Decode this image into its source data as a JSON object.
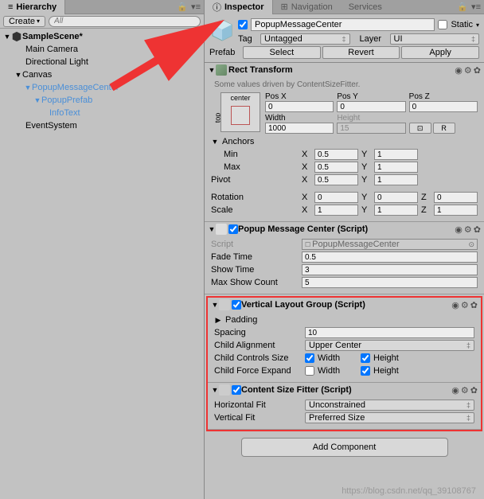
{
  "hierarchy": {
    "title": "Hierarchy",
    "create": "Create",
    "search_placeholder": "All",
    "scene": "SampleScene*",
    "items": [
      "Main Camera",
      "Directional Light",
      "Canvas",
      "PopupMessageCenter",
      "PopupPrefab",
      "InfoText",
      "EventSystem"
    ]
  },
  "inspector": {
    "tabs": {
      "inspector": "Inspector",
      "navigation": "Navigation",
      "services": "Services"
    },
    "name": "PopupMessageCenter",
    "static_label": "Static",
    "tag_label": "Tag",
    "tag_value": "Untagged",
    "layer_label": "Layer",
    "layer_value": "UI",
    "prefab_label": "Prefab",
    "prefab_select": "Select",
    "prefab_revert": "Revert",
    "prefab_apply": "Apply"
  },
  "rect_transform": {
    "title": "Rect Transform",
    "info": "Some values driven by ContentSizeFitter.",
    "preset_h": "center",
    "preset_v": "top",
    "posx_label": "Pos X",
    "posx": "0",
    "posy_label": "Pos Y",
    "posy": "0",
    "posz_label": "Pos Z",
    "posz": "0",
    "width_label": "Width",
    "width": "1000",
    "height_label": "Height",
    "height": "15",
    "blueprint": "⊡",
    "raw": "R",
    "anchors_label": "Anchors",
    "min_label": "Min",
    "min_x": "0.5",
    "min_y": "1",
    "max_label": "Max",
    "max_x": "0.5",
    "max_y": "1",
    "pivot_label": "Pivot",
    "pivot_x": "0.5",
    "pivot_y": "1",
    "rotation_label": "Rotation",
    "rot_x": "0",
    "rot_y": "0",
    "rot_z": "0",
    "scale_label": "Scale",
    "scale_x": "1",
    "scale_y": "1",
    "scale_z": "1"
  },
  "popup_script": {
    "title": "Popup Message Center (Script)",
    "script_label": "Script",
    "script_value": "PopupMessageCenter",
    "fade_label": "Fade Time",
    "fade": "0.5",
    "show_label": "Show Time",
    "show": "3",
    "max_label": "Max Show Count",
    "max": "5"
  },
  "vlg": {
    "title": "Vertical Layout Group (Script)",
    "padding_label": "Padding",
    "spacing_label": "Spacing",
    "spacing": "10",
    "align_label": "Child Alignment",
    "align": "Upper Center",
    "controls_label": "Child Controls Size",
    "width": "Width",
    "height": "Height",
    "expand_label": "Child Force Expand"
  },
  "csf": {
    "title": "Content Size Fitter (Script)",
    "hfit_label": "Horizontal Fit",
    "hfit": "Unconstrained",
    "vfit_label": "Vertical Fit",
    "vfit": "Preferred Size"
  },
  "add_component": "Add Component",
  "watermark": "https://blog.csdn.net/qq_39108767"
}
